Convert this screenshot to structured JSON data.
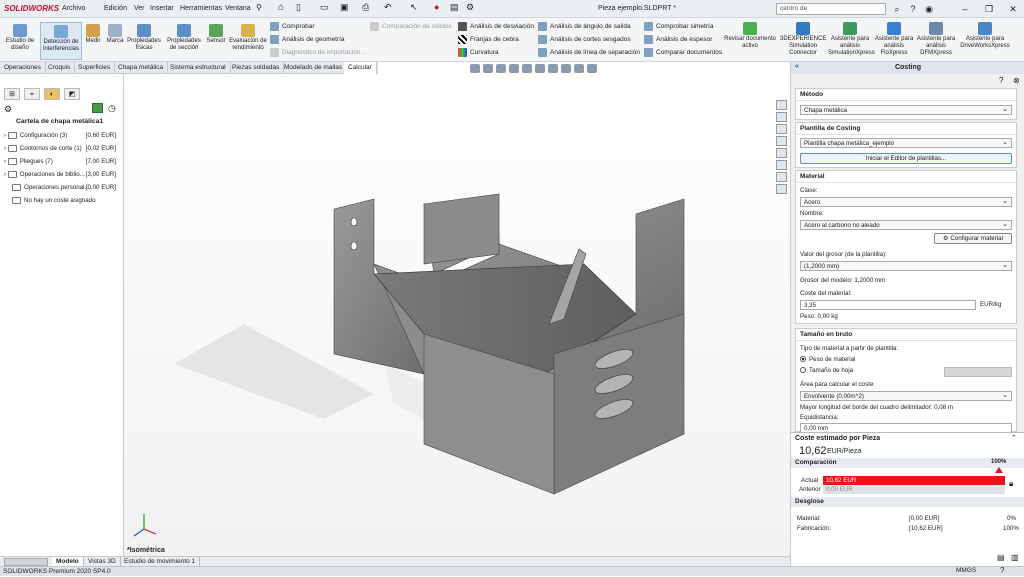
{
  "app": {
    "logo": "SOLIDWORKS",
    "doc_title": "Pieza ejemplo.SLDPRT *",
    "search_placeholder": "centro de",
    "status": "SOLIDWORKS Premium 2020 SP4.0",
    "units": "MMGS"
  },
  "menu": [
    "Archivo",
    "Edición",
    "Ver",
    "Insertar",
    "Herramientas",
    "Ventana"
  ],
  "ribbon": {
    "big": [
      {
        "label": "Estudio de diseño",
        "icon": "design-study-icon"
      },
      {
        "label": "Detección de interferencias",
        "icon": "interference-icon"
      },
      {
        "label": "Medir",
        "icon": "measure-icon"
      },
      {
        "label": "Marca",
        "icon": "markup-icon"
      },
      {
        "label": "Propiedades físicas",
        "icon": "mass-properties-icon"
      },
      {
        "label": "Propiedades de sección",
        "icon": "section-properties-icon"
      },
      {
        "label": "Sensor",
        "icon": "sensor-icon"
      },
      {
        "label": "Evaluación de rendimiento",
        "icon": "performance-icon"
      }
    ],
    "small_col1": [
      {
        "label": "Comprobar",
        "dim": false
      },
      {
        "label": "Análisis de geometría",
        "dim": false
      },
      {
        "label": "Diagnóstico de importación...",
        "dim": true
      }
    ],
    "comparacion": "Comparación de sólidos",
    "small_col2": [
      "Análisis de desviación",
      "Franjas de cebra",
      "Curvatura"
    ],
    "small_col3": [
      "Análisis de ángulo de salida",
      "Análisis de cortes sesgados",
      "Análisis de línea de separación"
    ],
    "small_col4": [
      "Comprobar simetría",
      "Análisis de espesor",
      "Comparar documentos"
    ],
    "revisar": "Revisar documento activo",
    "addins": [
      "3DEXPERIENCE Simulation Connector",
      "Asistente para análisis SimulationXpress",
      "Asistente para análisis FloXpress",
      "Asistente para análisis DFMXpress",
      "Asistente para DriveWorksXpress"
    ]
  },
  "tabs": [
    "Operaciones",
    "Croquis",
    "Superficies",
    "Chapa metálica",
    "Sistema estructural",
    "Piezas soldadas",
    "Modelado de mallas",
    "Calcular"
  ],
  "active_tab": "Calcular",
  "feature_manager": {
    "title": "Cartela de chapa metálica1",
    "items": [
      {
        "label": "Configuración (3)",
        "amount": "[0,60 EUR]"
      },
      {
        "label": "Contornos de corte (1)",
        "amount": "[0,02 EUR]"
      },
      {
        "label": "Pliegues (7)",
        "amount": "[7,00 EUR]"
      },
      {
        "label": "Operaciones de biblio...",
        "amount": "[3,00 EUR]"
      },
      {
        "label": "Operaciones personal...",
        "amount": "[0,00 EUR]"
      },
      {
        "label": "No hay un coste asignado",
        "amount": ""
      }
    ]
  },
  "view": {
    "orientation": "*Isométrica"
  },
  "bottom_tabs": [
    "Modelo",
    "Vistas 3D",
    "Estudio de movimiento 1"
  ],
  "costing": {
    "title": "Costing",
    "metodo_label": "Método",
    "metodo": "Chapa metálica",
    "plantilla_label": "Plantilla de Costing",
    "plantilla": "Plantilla chapa metálica_ejemplo",
    "editor_btn": "Iniciar el Editor de plantillas...",
    "material_label": "Material",
    "clase_label": "Clase:",
    "clase": "Acero",
    "nombre_label": "Nombre:",
    "nombre": "Acero al carbono no aleado",
    "config_btn": "Configurar material",
    "grosor_label": "Valor del grosor (de la plantilla):",
    "grosor": "(1,2000 mm)",
    "grosor_modelo": "Grosor del modelo: 1,2000 mm",
    "coste_mat_label": "Coste del material:",
    "coste_mat": "3,35",
    "coste_unit": "EUR/kg",
    "peso": "Peso: 0,00 kg",
    "tamano_label": "Tamaño en bruto",
    "tipo_label": "Tipo de material a partir de plantilla:",
    "radio1": "Peso de material",
    "radio2": "Tamaño de hoja",
    "area_label": "Área para calcular el coste:",
    "area": "Envolvente (0,00m^2)",
    "borde": "Mayor longitud del borde del cuadro delimitador: 0,08 m",
    "equi_label": "Equidistancia:",
    "equi": "0,00 mm",
    "estimado_label": "Coste estimado por Pieza",
    "estimado": "10,62",
    "estimado_unit": "EUR/Pieza",
    "comparacion_label": "Comparación",
    "pct": "100%",
    "actual_label": "Actual",
    "actual_val": "10,62 EUR",
    "anterior_label": "Anterior",
    "anterior_val": "0,00 EUR",
    "actual_fraction": 1.0,
    "desglose_label": "Desglose",
    "mat_row": {
      "label": "Material:",
      "val": "[0,00 EUR]",
      "pct": "0%"
    },
    "fab_row": {
      "label": "Fabricación:",
      "val": "[10,62 EUR]",
      "pct": "100%"
    }
  },
  "colors": {
    "accent": "#c8102e",
    "bar": "#e8141c",
    "tab_bg": "#e6e9ec"
  }
}
